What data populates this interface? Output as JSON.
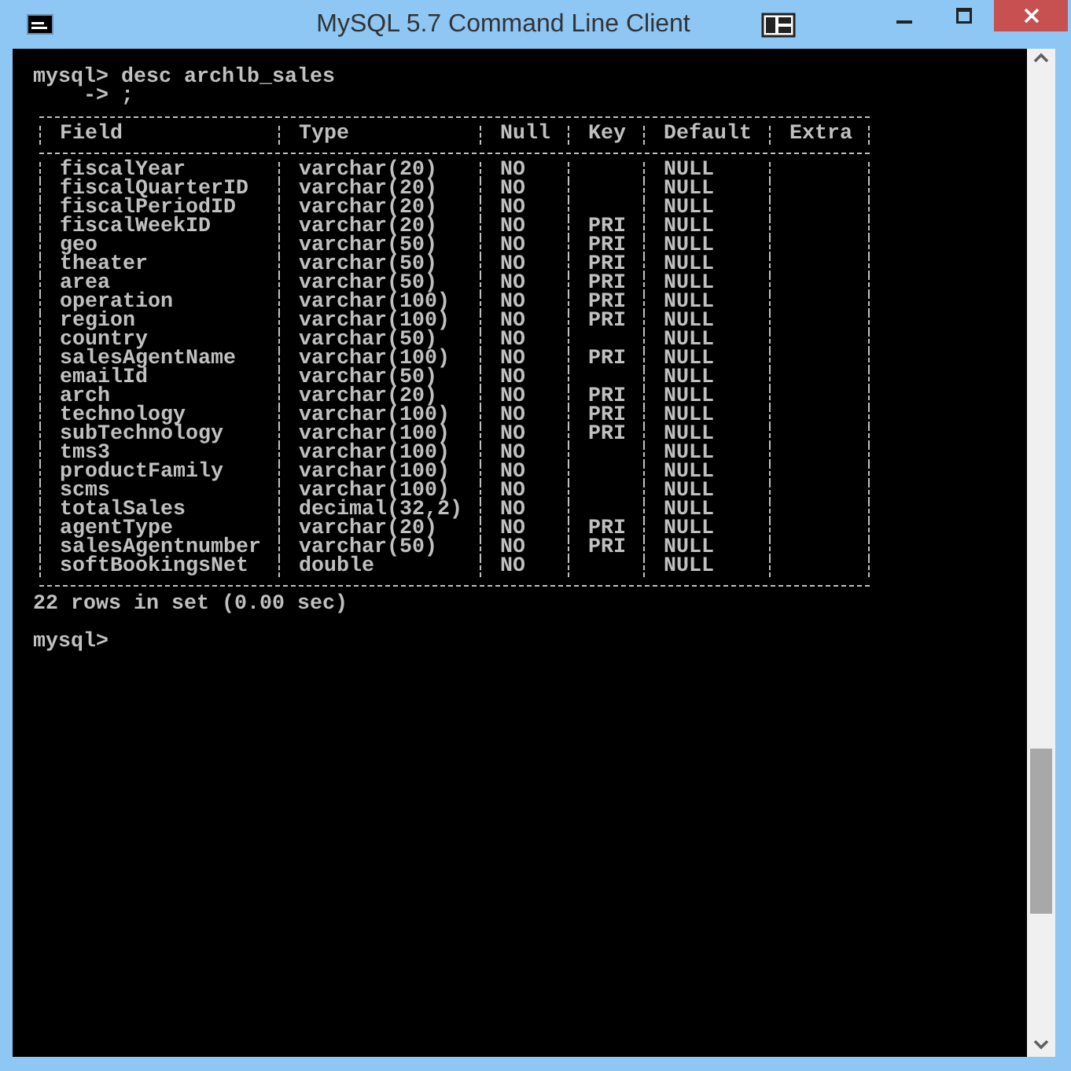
{
  "window": {
    "title": "MySQL 5.7 Command Line Client"
  },
  "console": {
    "command": "mysql> desc archlb_sales",
    "continuation": "-> ;",
    "table": {
      "columns": [
        "Field",
        "Type",
        "Null",
        "Key",
        "Default",
        "Extra"
      ],
      "rows": [
        {
          "field": "fiscalYear",
          "type": "varchar(20)",
          "null": "NO",
          "default": "NULL"
        },
        {
          "field": "fiscalQuarterID",
          "type": "varchar(20)",
          "null": "NO",
          "default": "NULL"
        },
        {
          "field": "fiscalPeriodID",
          "type": "varchar(20)",
          "null": "NO",
          "default": "NULL"
        },
        {
          "field": "fiscalWeekID",
          "type": "varchar(20)",
          "null": "NO",
          "key": "PRI",
          "default": "NULL"
        },
        {
          "field": "geo",
          "type": "varchar(50)",
          "null": "NO",
          "key": "PRI",
          "default": "NULL"
        },
        {
          "field": "theater",
          "type": "varchar(50)",
          "null": "NO",
          "key": "PRI",
          "default": "NULL"
        },
        {
          "field": "area",
          "type": "varchar(50)",
          "null": "NO",
          "key": "PRI",
          "default": "NULL"
        },
        {
          "field": "operation",
          "type": "varchar(100)",
          "null": "NO",
          "key": "PRI",
          "default": "NULL"
        },
        {
          "field": "region",
          "type": "varchar(100)",
          "null": "NO",
          "key": "PRI",
          "default": "NULL"
        },
        {
          "field": "country",
          "type": "varchar(50)",
          "null": "NO",
          "default": "NULL"
        },
        {
          "field": "salesAgentName",
          "type": "varchar(100)",
          "null": "NO",
          "key": "PRI",
          "default": "NULL"
        },
        {
          "field": "emailId",
          "type": "varchar(50)",
          "null": "NO",
          "default": "NULL"
        },
        {
          "field": "arch",
          "type": "varchar(20)",
          "null": "NO",
          "key": "PRI",
          "default": "NULL"
        },
        {
          "field": "technology",
          "type": "varchar(100)",
          "null": "NO",
          "key": "PRI",
          "default": "NULL"
        },
        {
          "field": "subTechnology",
          "type": "varchar(100)",
          "null": "NO",
          "key": "PRI",
          "default": "NULL"
        },
        {
          "field": "tms3",
          "type": "varchar(100)",
          "null": "NO",
          "default": "NULL"
        },
        {
          "field": "productFamily",
          "type": "varchar(100)",
          "null": "NO",
          "default": "NULL"
        },
        {
          "field": "scms",
          "type": "varchar(100)",
          "null": "NO",
          "default": "NULL"
        },
        {
          "field": "totalSales",
          "type": "decimal(32,2)",
          "null": "NO",
          "default": "NULL"
        },
        {
          "field": "agentType",
          "type": "varchar(20)",
          "null": "NO",
          "key": "PRI",
          "default": "NULL"
        },
        {
          "field": "salesAgentnumber",
          "type": "varchar(50)",
          "null": "NO",
          "key": "PRI",
          "default": "NULL"
        },
        {
          "field": "softBookingsNet",
          "type": "double",
          "null": "NO",
          "default": "NULL"
        }
      ]
    },
    "result": "22 rows in set (0.00 sec)",
    "prompt": "mysql>"
  }
}
